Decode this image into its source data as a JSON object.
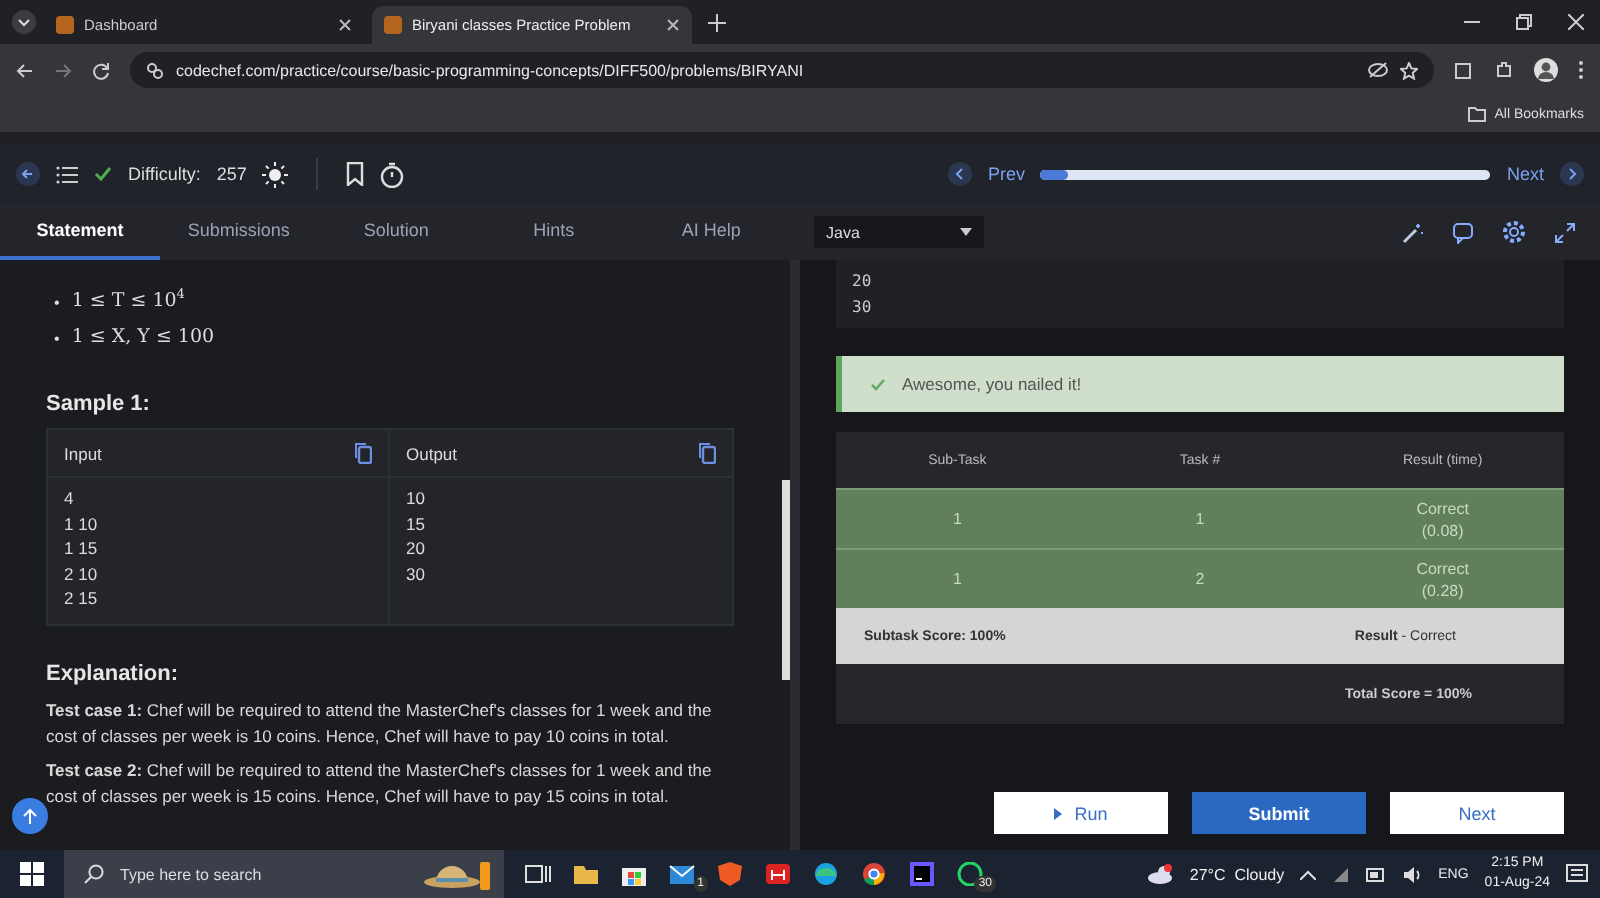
{
  "browser_tabs": [
    {
      "title": "Dashboard",
      "selected": false
    },
    {
      "title": "Biryani classes Practice Problem",
      "selected": true
    }
  ],
  "address_bar": {
    "url": "codechef.com/practice/course/basic-programming-concepts/DIFF500/problems/BIRYANI"
  },
  "bookmarks_bar": {
    "label": "All Bookmarks"
  },
  "toolbar": {
    "difficulty_label": "Difficulty:",
    "difficulty": "257",
    "prev": "Prev",
    "next": "Next",
    "progress": {
      "level": 0.06
    }
  },
  "problem_tabs": [
    {
      "label": "Statement",
      "selected": true
    },
    {
      "label": "Submissions",
      "selected": false
    },
    {
      "label": "Solution",
      "selected": false
    },
    {
      "label": "Hints",
      "selected": false
    },
    {
      "label": "AI Help",
      "selected": false
    }
  ],
  "language_select": {
    "value": "Java"
  },
  "statement": {
    "constraints": [
      {
        "marker": "•",
        "text": "1 ≤ T ≤ 10$^{4}$"
      },
      {
        "marker": "•",
        "text": "1 ≤ X, Y ≤ 100"
      }
    ],
    "sample_title": "Sample 1:",
    "sample": {
      "input_label": "Input",
      "output_label": "Output",
      "input": [
        "4",
        "1 10",
        "1 15",
        "2 10",
        "2 15"
      ],
      "output": [
        "10",
        "15",
        "20",
        "30"
      ]
    },
    "explanation_title": "Explanation:",
    "explanations": [
      "**Test case 1:** Chef will be required to attend the MasterChef's classes for 1 week and the cost of classes per week is 10 coins. Hence, Chef will have to pay 10 coins in total.",
      "**Test case 2:** Chef will be required to attend the MasterChef's classes for 1 week and the cost of classes per week is 15 coins. Hence, Chef will have to pay 15 coins in total."
    ]
  },
  "output_lines": [
    "20",
    "30"
  ],
  "result_banner": "Awesome, you nailed it!",
  "results_table": {
    "columns": [
      "Sub-Task",
      "Task #",
      "Result (time)"
    ],
    "rows": [
      {
        "sub_task": "1",
        "task": "1",
        "result": "Correct",
        "time": "(0.08)"
      },
      {
        "sub_task": "1",
        "task": "2",
        "result": "Correct",
        "time": "(0.28)"
      }
    ],
    "subtask_score": "Subtask Score: 100%",
    "result": "**Result** - Correct",
    "total_score": "Total Score = 100%"
  },
  "actions": {
    "run": "Run",
    "submit": "Submit",
    "next": "Next"
  },
  "taskbar": {
    "search_placeholder": "Type here to search",
    "mail_badge": "1",
    "chat_badge": "30",
    "weather": "27°C  Cloudy",
    "language": "ENG",
    "time": "2:15 PM",
    "date": "01-Aug-24"
  }
}
